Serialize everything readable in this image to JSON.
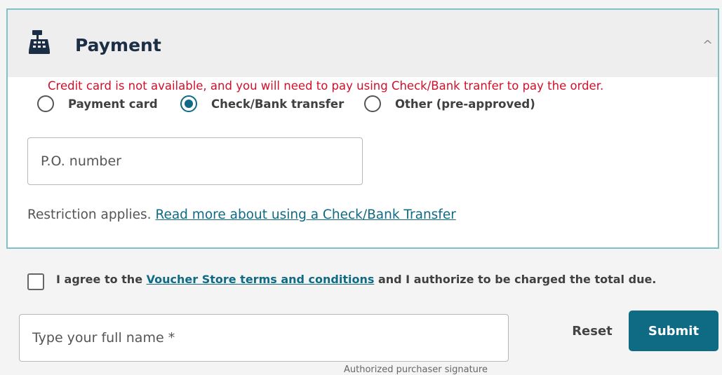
{
  "payment": {
    "title": "Payment",
    "header_icon": "cash-register-icon",
    "collapse_icon": "chevron-up-icon",
    "collapse_glyph": "^",
    "error_message": "Credit card is not available, and you will need to pay using Check/Bank tranfer to pay the order.",
    "options": [
      {
        "label": "Payment card",
        "checked": false
      },
      {
        "label": "Check/Bank transfer",
        "checked": true
      },
      {
        "label": "Other (pre-approved)",
        "checked": false
      }
    ],
    "po_placeholder": "P.O. number",
    "restriction_text": "Restriction applies.",
    "restriction_link": "Read more about using a Check/Bank Transfer"
  },
  "agreement": {
    "text_before": "I agree to the",
    "link": "Voucher Store terms and conditions",
    "text_after": "and I authorize to be charged the total due.",
    "checked": false
  },
  "signature": {
    "name_placeholder": "Type your full name *",
    "caption": "Authorized purchaser signature"
  },
  "actions": {
    "reset_label": "Reset",
    "submit_label": "Submit"
  },
  "colors": {
    "accent": "#0f6a83",
    "error": "#d0102b",
    "panel_border": "#7fc2c6",
    "header_bg": "#eeeeee",
    "page_bg": "#f4f4f4"
  }
}
